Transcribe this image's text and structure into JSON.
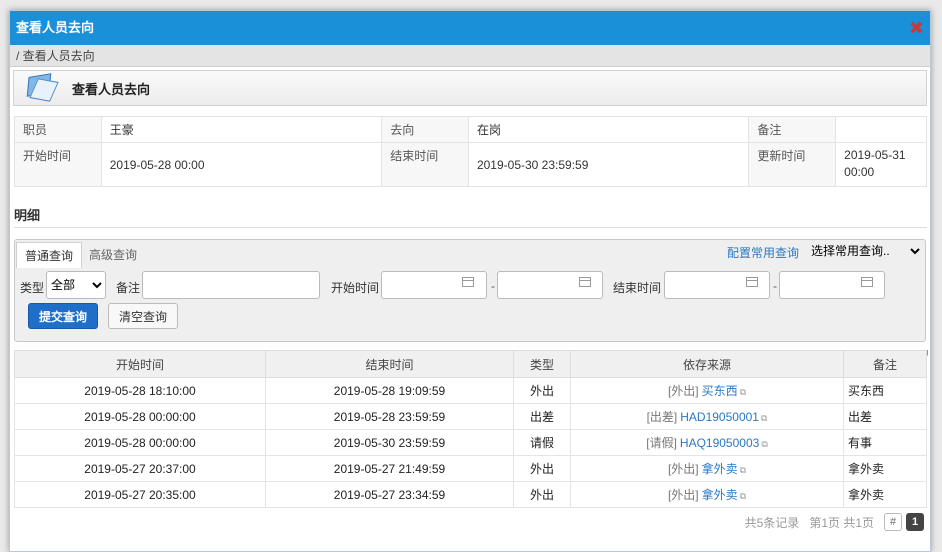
{
  "dialog": {
    "title": "查看人员去向",
    "breadcrumb": "/ 查看人员去向",
    "header_title": "查看人员去向"
  },
  "info": {
    "employee_label": "职员",
    "employee_value": "王豪",
    "whereabouts_label": "去向",
    "whereabouts_value": "在岗",
    "remark_label": "备注",
    "remark_value": "",
    "start_label": "开始时间",
    "start_value": "2019-05-28 00:00",
    "end_label": "结束时间",
    "end_value": "2019-05-30 23:59:59",
    "updated_label": "更新时间",
    "updated_value": "2019-05-31 00:00"
  },
  "detail_heading": "明细",
  "query": {
    "tab_normal": "普通查询",
    "tab_advanced": "高级查询",
    "config_link": "配置常用查询",
    "common_select": "选择常用查询..",
    "type_label": "类型",
    "type_value": "全部",
    "remark_label": "备注",
    "start_label": "开始时间",
    "end_label": "结束时间",
    "range_sep": "-",
    "submit": "提交查询",
    "clear": "清空查询"
  },
  "table": {
    "headers": [
      "开始时间",
      "结束时间",
      "类型",
      "依存来源",
      "备注"
    ],
    "rows": [
      {
        "start": "2019-05-28 18:10:00",
        "end": "2019-05-28 19:09:59",
        "type": "外出",
        "src_tag": "[外出]",
        "src_link": "买东西",
        "note": "买东西"
      },
      {
        "start": "2019-05-28 00:00:00",
        "end": "2019-05-28 23:59:59",
        "type": "出差",
        "src_tag": "[出差]",
        "src_link": "HAD19050001",
        "note": "出差"
      },
      {
        "start": "2019-05-28 00:00:00",
        "end": "2019-05-30 23:59:59",
        "type": "请假",
        "src_tag": "[请假]",
        "src_link": "HAQ19050003",
        "note": "有事"
      },
      {
        "start": "2019-05-27 20:37:00",
        "end": "2019-05-27 21:49:59",
        "type": "外出",
        "src_tag": "[外出]",
        "src_link": "拿外卖",
        "note": "拿外卖"
      },
      {
        "start": "2019-05-27 20:35:00",
        "end": "2019-05-27 23:34:59",
        "type": "外出",
        "src_tag": "[外出]",
        "src_link": "拿外卖",
        "note": "拿外卖"
      }
    ]
  },
  "pager": {
    "total": "共5条记录",
    "page_info": "第1页 共1页",
    "hash": "#",
    "current": "1"
  }
}
